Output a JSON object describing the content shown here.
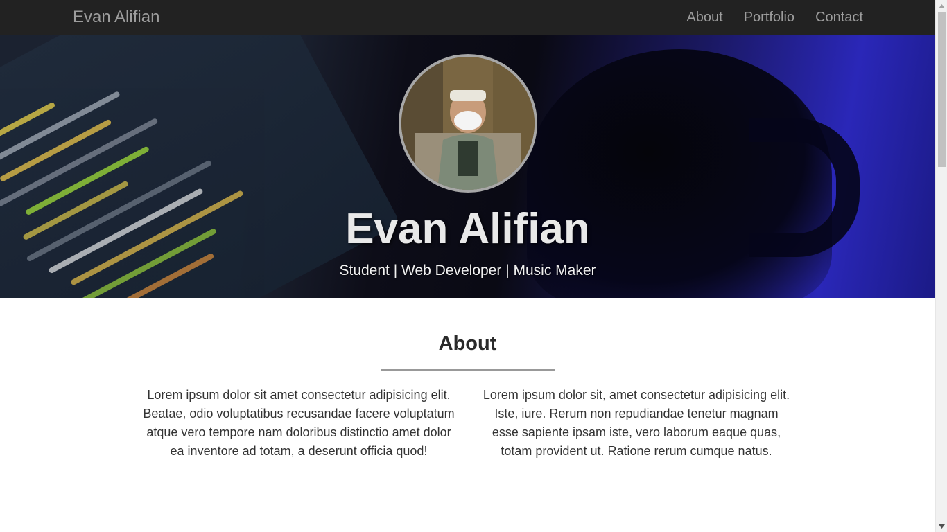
{
  "navbar": {
    "brand": "Evan Alifian",
    "links": [
      "About",
      "Portfolio",
      "Contact"
    ]
  },
  "hero": {
    "name": "Evan Alifian",
    "tagline": "Student | Web Developer | Music Maker"
  },
  "about": {
    "title": "About",
    "left_text": "Lorem ipsum dolor sit amet consectetur adipisicing elit. Beatae, odio voluptatibus recusandae facere voluptatum atque vero tempore nam doloribus distinctio amet dolor ea inventore ad totam, a deserunt officia quod!",
    "right_text": "Lorem ipsum dolor sit, amet consectetur adipisicing elit. Iste, iure. Rerum non repudiandae tenetur magnam esse sapiente ipsam iste, vero laborum eaque quas, totam provident ut. Ratione rerum cumque natus."
  },
  "colors": {
    "navbar_bg": "#222222",
    "nav_text": "#9d9d9d",
    "rule": "#999999"
  },
  "icons": {
    "scroll_up": "triangle-up-icon",
    "scroll_down": "triangle-down-icon"
  }
}
